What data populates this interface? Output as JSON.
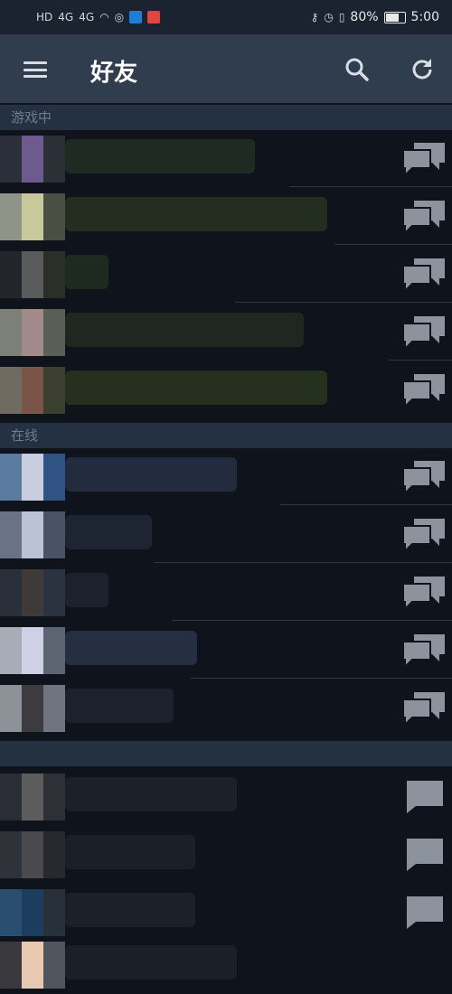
{
  "status_bar": {
    "network": "HD",
    "signal_1": "4G",
    "signal_2": "4G",
    "battery_level": 0.8,
    "battery_text": "80%",
    "time": "5:00"
  },
  "header": {
    "title": "好友",
    "menu_icon": "hamburger-menu-icon",
    "search_icon": "search-icon",
    "refresh_icon": "refresh-icon"
  },
  "sections": [
    {
      "label": "游戏中"
    },
    {
      "label": "在线"
    }
  ],
  "colors": {
    "app_bar": "#2f3d4f",
    "background": "#0f141c",
    "section_header": "#243142",
    "section_text": "#6d7c8f",
    "chat_icon": "#8d939c"
  }
}
